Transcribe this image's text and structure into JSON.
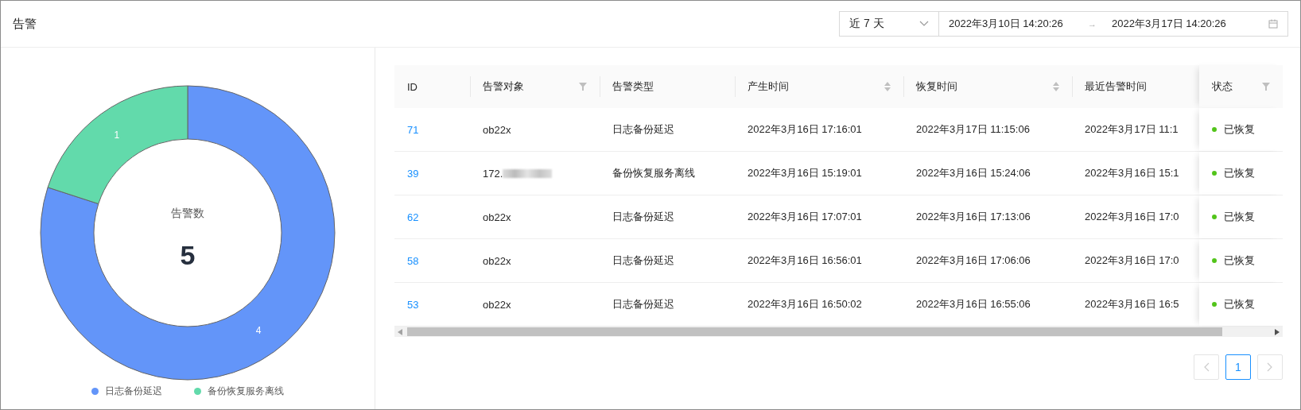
{
  "header": {
    "title": "告警",
    "range": {
      "preset": "近 7 天",
      "start": "2022年3月10日 14:20:26",
      "arrow": "→",
      "end": "2022年3月17日 14:20:26"
    }
  },
  "chart": {
    "center_label": "告警数",
    "center_value": "5",
    "chart_data": {
      "type": "donut",
      "categories": [
        "日志备份延迟",
        "备份恢复服务离线"
      ],
      "values": [
        4,
        1
      ],
      "data_labels": true
    },
    "legend": [
      {
        "color": "#6395f9"
      },
      {
        "color": "#62daab"
      }
    ]
  },
  "table": {
    "columns": [
      {
        "label": "ID",
        "kind": "plain"
      },
      {
        "label": "告警对象",
        "kind": "filter"
      },
      {
        "label": "告警类型",
        "kind": "plain"
      },
      {
        "label": "产生时间",
        "kind": "sort"
      },
      {
        "label": "恢复时间",
        "kind": "sort"
      },
      {
        "label": "最近告警时间",
        "kind": "plain"
      },
      {
        "label": "状态",
        "kind": "filter"
      }
    ],
    "rows": [
      {
        "id": "71",
        "target": "ob22x",
        "target_redacted": false,
        "type": "日志备份延迟",
        "created": "2022年3月16日 17:16:01",
        "recovered": "2022年3月17日 11:15:06",
        "latest": "2022年3月17日 11:1",
        "status": "已恢复",
        "color": "#52c41a"
      },
      {
        "id": "39",
        "target": "172.",
        "target_redacted": true,
        "type": "备份恢复服务离线",
        "created": "2022年3月16日 15:19:01",
        "recovered": "2022年3月16日 15:24:06",
        "latest": "2022年3月16日 15:1",
        "status": "已恢复",
        "color": "#52c41a"
      },
      {
        "id": "62",
        "target": "ob22x",
        "target_redacted": false,
        "type": "日志备份延迟",
        "created": "2022年3月16日 17:07:01",
        "recovered": "2022年3月16日 17:13:06",
        "latest": "2022年3月16日 17:0",
        "status": "已恢复",
        "color": "#52c41a"
      },
      {
        "id": "58",
        "target": "ob22x",
        "target_redacted": false,
        "type": "日志备份延迟",
        "created": "2022年3月16日 16:56:01",
        "recovered": "2022年3月16日 17:06:06",
        "latest": "2022年3月16日 17:0",
        "status": "已恢复",
        "color": "#52c41a"
      },
      {
        "id": "53",
        "target": "ob22x",
        "target_redacted": false,
        "type": "日志备份延迟",
        "created": "2022年3月16日 16:50:02",
        "recovered": "2022年3月16日 16:55:06",
        "latest": "2022年3月16日 16:5",
        "status": "已恢复",
        "color": "#52c41a"
      }
    ]
  },
  "pagination": {
    "prev_disabled": true,
    "next_disabled": true,
    "pages": [
      {
        "label": "1",
        "selected": true
      }
    ]
  }
}
